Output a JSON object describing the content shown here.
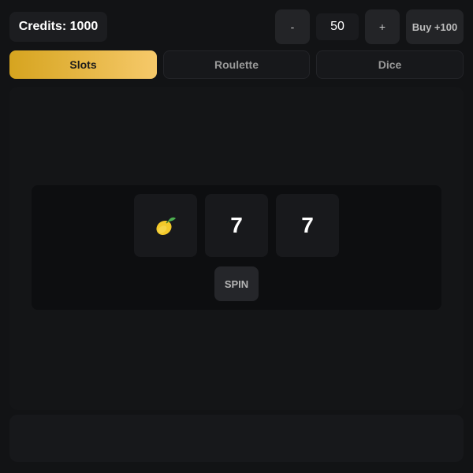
{
  "header": {
    "credits_label": "Credits: 1000",
    "decrease_label": "-",
    "bet_value": "50",
    "increase_label": "+",
    "buy_label": "Buy +100"
  },
  "tabs": [
    {
      "label": "Slots",
      "active": true
    },
    {
      "label": "Roulette",
      "active": false
    },
    {
      "label": "Dice",
      "active": false
    }
  ],
  "slots": {
    "reels": [
      {
        "symbol": "lemon-icon",
        "text": ""
      },
      {
        "symbol": "seven",
        "text": "7"
      },
      {
        "symbol": "seven",
        "text": "7"
      }
    ],
    "spin_label": "SPIN"
  },
  "colors": {
    "accent_start": "#d6a41f",
    "accent_end": "#f6c96a",
    "background": "#121315"
  }
}
